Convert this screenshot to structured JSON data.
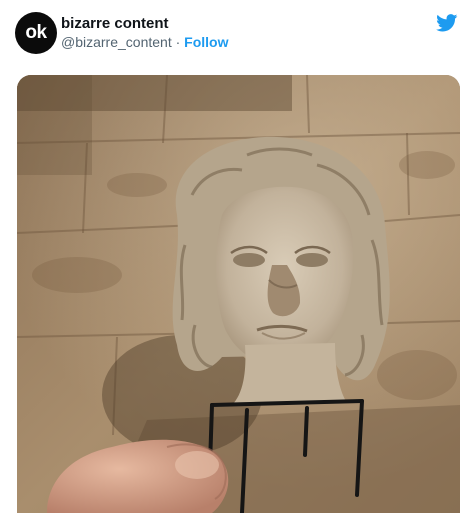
{
  "tweet": {
    "avatar_text": "ok",
    "display_name": "bizarre content",
    "handle": "@bizarre_content",
    "separator": "·",
    "follow_label": "Follow"
  },
  "photo": {
    "icon": "statue-photo"
  },
  "colors": {
    "follow_blue": "#1d9bf0",
    "avatar_bg": "#0b0b0b",
    "text_primary": "#0f1419",
    "text_secondary": "#536471"
  }
}
